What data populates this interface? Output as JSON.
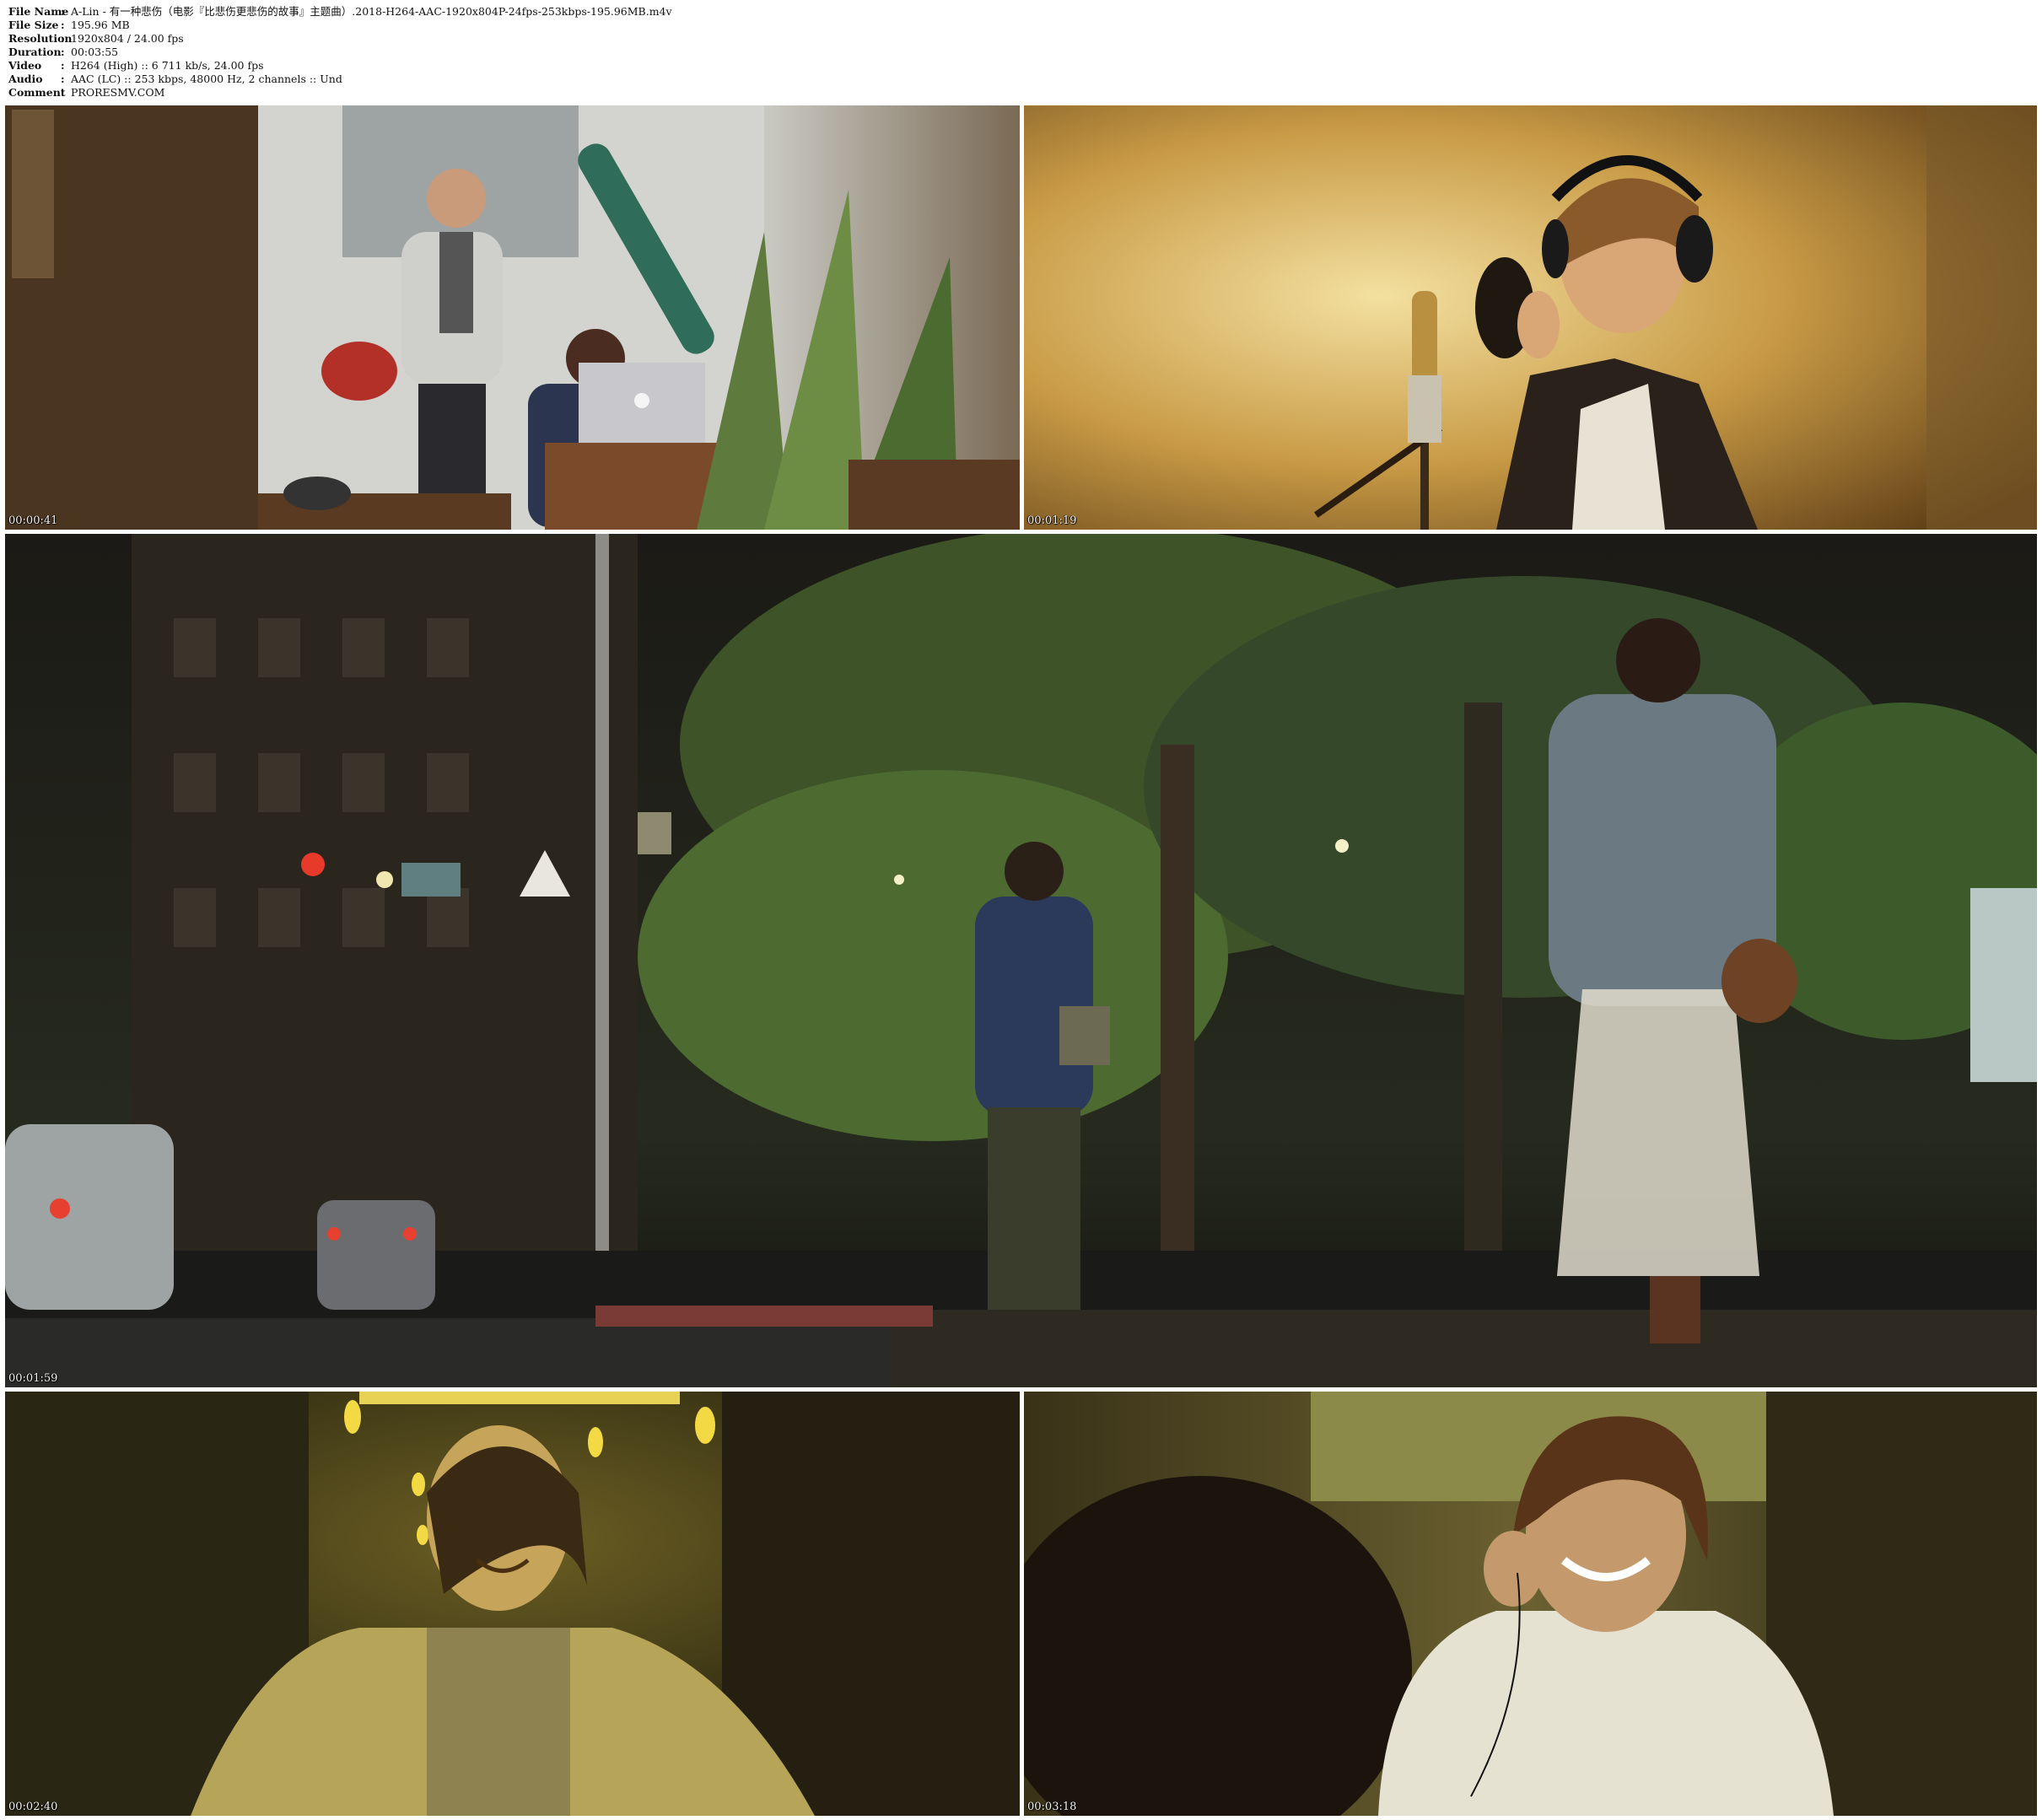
{
  "info": {
    "rows": [
      {
        "label": "File Name",
        "value": "A-Lin - 有一种悲伤（电影『比悲伤更悲伤的故事』主题曲）.2018-H264-AAC-1920x804P-24fps-253kbps-195.96MB.m4v"
      },
      {
        "label": "File Size",
        "value": "195.96 MB"
      },
      {
        "label": "Resolution",
        "value": "1920x804 / 24.00 fps"
      },
      {
        "label": "Duration",
        "value": "00:03:55"
      },
      {
        "label": "Video",
        "value": "H264 (High) :: 6 711 kb/s, 24.00 fps"
      },
      {
        "label": "Audio",
        "value": "AAC (LC) :: 253 kbps, 48000 Hz, 2 channels :: Und"
      },
      {
        "label": "Comment",
        "value": "PRORESMV.COM"
      }
    ],
    "separator": ":"
  },
  "frames": [
    {
      "timestamp": "00:00:41"
    },
    {
      "timestamp": "00:01:19"
    },
    {
      "timestamp": "00:01:59"
    },
    {
      "timestamp": "00:02:40"
    },
    {
      "timestamp": "00:03:18"
    }
  ]
}
